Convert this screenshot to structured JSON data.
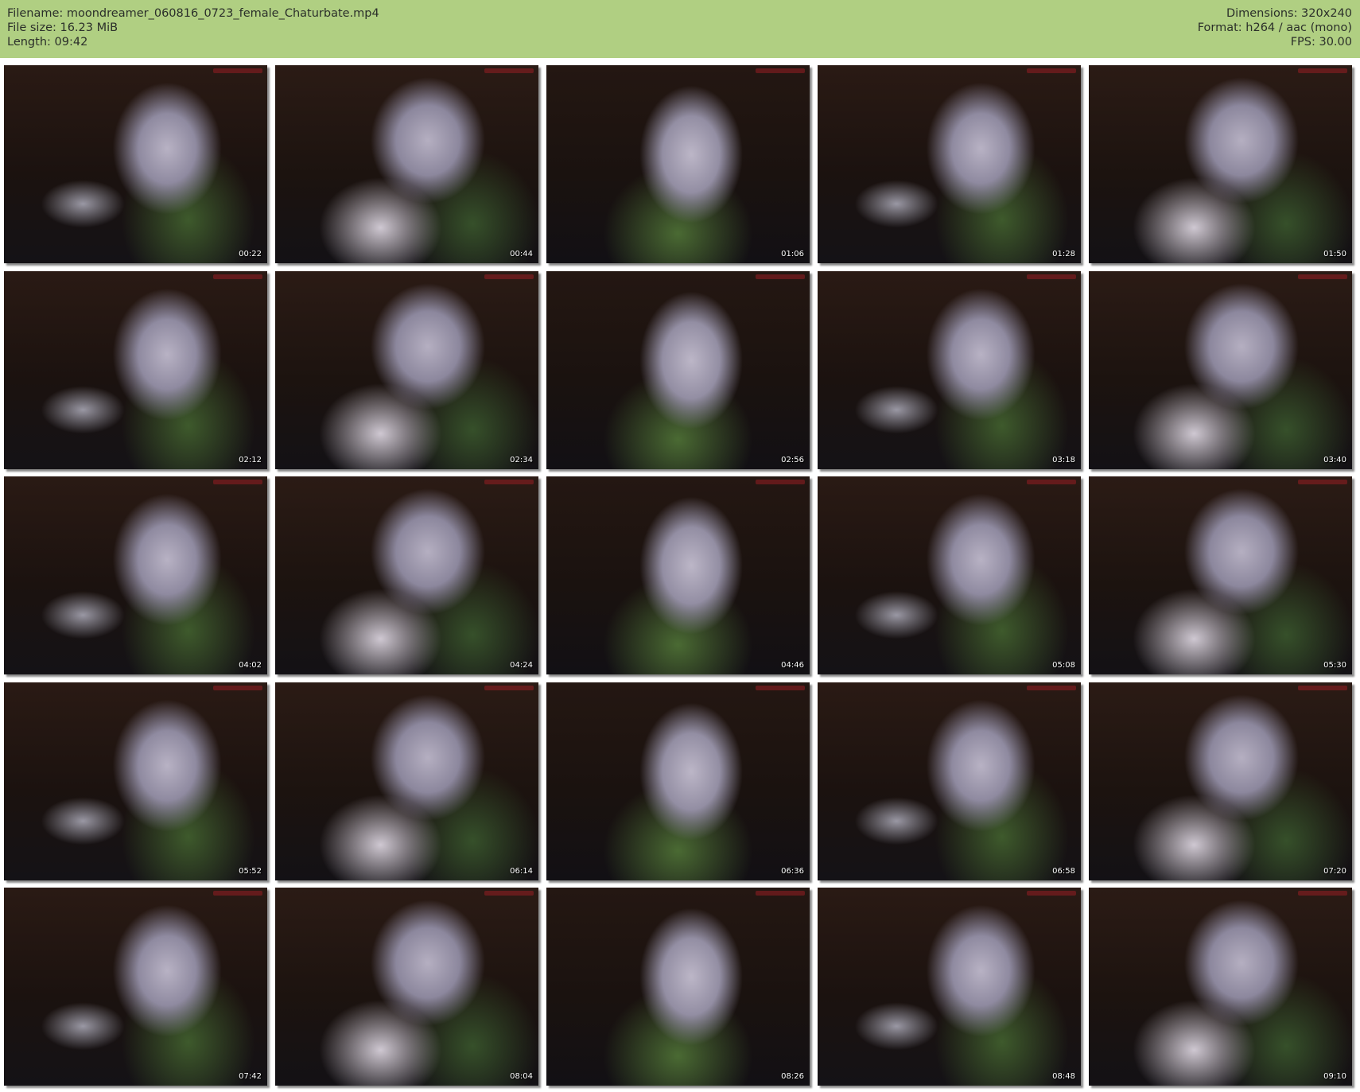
{
  "header": {
    "filename": "Filename: moondreamer_060816_0723_female_Chaturbate.mp4",
    "filesize": "File size: 16.23 MiB",
    "length": "Length: 09:42",
    "dimensions": "Dimensions: 320x240",
    "format": "Format: h264 / aac (mono)",
    "fps": "FPS: 30.00"
  },
  "colors": {
    "header_background": "#b0cf82",
    "page_background": "#ffffff",
    "timestamp_text": "#ffffff"
  },
  "grid": {
    "columns": 5,
    "rows": 5
  },
  "thumbnails": [
    {
      "timestamp": "00:22"
    },
    {
      "timestamp": "00:44"
    },
    {
      "timestamp": "01:06"
    },
    {
      "timestamp": "01:28"
    },
    {
      "timestamp": "01:50"
    },
    {
      "timestamp": "02:12"
    },
    {
      "timestamp": "02:34"
    },
    {
      "timestamp": "02:56"
    },
    {
      "timestamp": "03:18"
    },
    {
      "timestamp": "03:40"
    },
    {
      "timestamp": "04:02"
    },
    {
      "timestamp": "04:24"
    },
    {
      "timestamp": "04:46"
    },
    {
      "timestamp": "05:08"
    },
    {
      "timestamp": "05:30"
    },
    {
      "timestamp": "05:52"
    },
    {
      "timestamp": "06:14"
    },
    {
      "timestamp": "06:36"
    },
    {
      "timestamp": "06:58"
    },
    {
      "timestamp": "07:20"
    },
    {
      "timestamp": "07:42"
    },
    {
      "timestamp": "08:04"
    },
    {
      "timestamp": "08:26"
    },
    {
      "timestamp": "08:48"
    },
    {
      "timestamp": "09:10"
    }
  ]
}
